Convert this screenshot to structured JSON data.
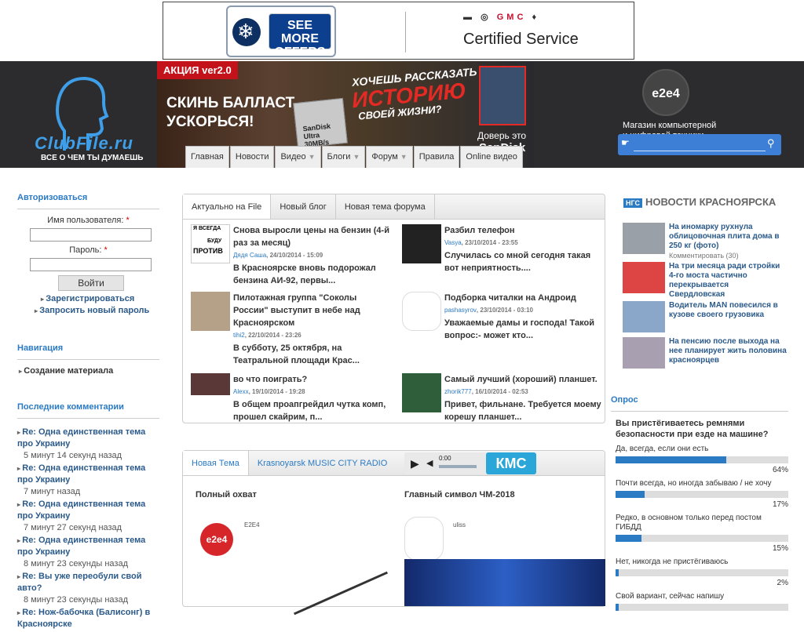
{
  "ad_top": {
    "see_more": "SEE MORE OFFERS",
    "brands": "— ◎ GMC —",
    "gmc": "GMC",
    "certified": "Certified Service"
  },
  "logo": {
    "name": "ClubFile.ru",
    "slogan": "ВСЕ О ЧЕМ ТЫ ДУМАЕШЬ"
  },
  "banner": {
    "promo": "АКЦИЯ ver2.0",
    "ballast_1": "СКИНЬ БАЛЛАСТ -",
    "ballast_2": "УСКОРЬСЯ!",
    "card_1": "SanDisk Ultra",
    "card_2": "30MB/s",
    "story_1": "ХОЧЕШЬ РАССКАЗАТЬ",
    "story_2": "ИСТОРИЮ",
    "story_3": "СВОЕЙ ЖИЗНИ?",
    "trust": "Доверь это",
    "sandisk": "SanDisk"
  },
  "nav": [
    {
      "label": "Главная",
      "caret": false
    },
    {
      "label": "Новости",
      "caret": false
    },
    {
      "label": "Видео",
      "caret": true
    },
    {
      "label": "Блоги",
      "caret": true
    },
    {
      "label": "Форум",
      "caret": true
    },
    {
      "label": "Правила",
      "caret": false
    },
    {
      "label": "Online видео",
      "caret": false
    }
  ],
  "e2e4": {
    "logo": "e2e4",
    "line1": "Магазин компьютерной",
    "line2": "и цифровой техники"
  },
  "search": {
    "placeholder": "",
    "value": ""
  },
  "login": {
    "heading": "Авторизоваться",
    "user_label": "Имя пользователя:",
    "pass_label": "Пароль:",
    "required": "*",
    "button": "Войти",
    "register": "Зарегистрироваться",
    "reset": "Запросить новый пароль"
  },
  "navigation": {
    "heading": "Навигация",
    "link": "Создание материала"
  },
  "comments": {
    "heading": "Последние комментарии",
    "items": [
      {
        "title": "Re: Одна единственная тема про Украину",
        "time": "5 минут 14 секунд назад"
      },
      {
        "title": "Re: Одна единственная тема про Украину",
        "time": "7 минут назад"
      },
      {
        "title": "Re: Одна единственная тема про Украину",
        "time": "7 минут 27 секунд назад"
      },
      {
        "title": "Re: Одна единственная тема про Украину",
        "time": "8 минут 23 секунды назад"
      },
      {
        "title": "Re: Вы уже переобули свой авто?",
        "time": "8 минут 23 секунды назад"
      },
      {
        "title": "Re: Нож-бабочка (Балисонг) в Красноярске",
        "time": ""
      }
    ]
  },
  "tabs1": [
    "Актуально на File",
    "Новый блог",
    "Новая тема форума"
  ],
  "news": [
    {
      "title": "Снова выросли цены на бензин (4-й раз за месяц)",
      "author": "Дядя Саша",
      "date": "24/10/2014 - 15:09",
      "text": "В Красноярске вновь подорожал бензина АИ-92, первы..."
    },
    {
      "title": "Разбил телефон",
      "author": "Vasya",
      "date": "23/10/2014 - 23:55",
      "text": "Случилась со мной сегодня такая вот неприятность...."
    },
    {
      "title": "Пилотажная группа \"Соколы России\" выступит в небе над Красноярском",
      "author": "tihi2",
      "date": "22/10/2014 - 23:26",
      "text": "В субботу, 25 октября, на Театральной площади Крас..."
    },
    {
      "title": "Подборка читалки на Андроид",
      "author": "pashasyrov",
      "date": "23/10/2014 - 03:10",
      "text": "Уважаемые дамы и господа! Такой вопрос:- может кто..."
    },
    {
      "title": "во что поиграть?",
      "author": "Alexx",
      "date": "19/10/2014 - 19:28",
      "text": "В общем проапгрейдил чутка комп, прошел скайрим, п..."
    },
    {
      "title": "Самый лучший (хороший) планшет.",
      "author": "zhorik777",
      "date": "16/10/2014 - 02:53",
      "text": "Привет, фильнане. Требуется моему корешу планшет..."
    }
  ],
  "thumb1_text": {
    "top": "Я ВСЕГДА",
    "bottom": "ПРОТИВ",
    "mid": "БУДУ"
  },
  "tabs2": {
    "new_topic": "Новая Тема",
    "radio": "Krasnoyarsk MUSIC CITY RADIO",
    "time": "0:00",
    "kms": "КМС"
  },
  "blog": [
    {
      "title": "Полный охват",
      "author": "E2E4",
      "logo": "e2e4"
    },
    {
      "title": "Главный символ ЧМ-2018",
      "author": "uliss"
    }
  ],
  "ngs": {
    "badge": "НГС",
    "heading": "НОВОСТИ КРАСНОЯРСКА",
    "items": [
      {
        "title": "На иномарку рухнула облицовочная плита дома в 250 кг (фото)",
        "comment": "Комментировать (30)"
      },
      {
        "title": "На три месяца ради стройки 4-го моста частично перекрывается Свердловская",
        "comment": ""
      },
      {
        "title": "Водитель MAN повесился в кузове своего грузовика",
        "comment": ""
      },
      {
        "title": "На пенсию после выхода на нее планирует жить половина красноярцев",
        "comment": ""
      }
    ]
  },
  "poll": {
    "heading": "Опрос",
    "question": "Вы пристёгиваетесь ремнями безопасности при езде на машине?",
    "options": [
      {
        "label": "Да, всегда, если они есть",
        "percent": "64%",
        "value": 64
      },
      {
        "label": "Почти всегда, но иногда забываю / не хочу",
        "percent": "17%",
        "value": 17
      },
      {
        "label": "Редко, в основном только перед постом ГИБДД",
        "percent": "15%",
        "value": 15
      },
      {
        "label": "Нет, никогда не пристёгиваюсь",
        "percent": "2%",
        "value": 2
      },
      {
        "label": "Свой вариант, сейчас напишу",
        "percent": "",
        "value": 2
      }
    ]
  },
  "colors": {
    "accent": "#2b7ac4",
    "header_bg": "#2c2c2e",
    "promo_red": "#c4121a",
    "search_blue": "#3d7fd6"
  }
}
